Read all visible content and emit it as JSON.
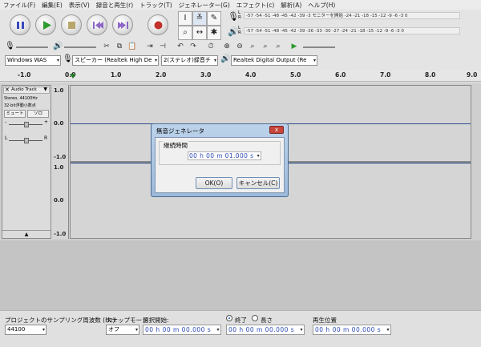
{
  "menu": [
    "ファイル(F)",
    "編集(E)",
    "表示(V)",
    "録音と再生(r)",
    "トラック(T)",
    "ジェネレーター(G)",
    "エフェクト(c)",
    "解析(A)",
    "ヘルプ(H)"
  ],
  "meters": {
    "record_scale": "-57 -54 -51 -48 -45 -42 -39 -3 モニターを開始 -24 -21 -18 -15 -12 -9 -6 -3 0",
    "play_scale": "-57 -54 -51 -48 -45 -42 -39 -36 -33 -30 -27 -24 -21 -18 -15 -12 -9 -6 -3 0",
    "record_lr": "L R",
    "play_lr": "L R"
  },
  "devices": {
    "host": "Windows WAS",
    "playback": "スピーカー (Realtek High De",
    "channels": "2(ステレオ)録音チ",
    "recording": "Realtek Digital Output (Re"
  },
  "ruler": {
    "labels": [
      "-1.0",
      "0.0",
      "1.0",
      "2.0",
      "3.0",
      "4.0",
      "5.0",
      "6.0",
      "7.0",
      "8.0",
      "9.0"
    ]
  },
  "track": {
    "name": "Audio Track",
    "info1": "Stereo, 44100Hz",
    "info2": "32-bit浮動小数点",
    "mute": "ミュート",
    "solo": "ソロ",
    "gain_minus": "-",
    "gain_plus": "+",
    "pan_left": "L",
    "pan_right": "R",
    "scale": [
      "1.0",
      "0.0",
      "-1.0",
      "1.0",
      "0.0",
      "-1.0"
    ]
  },
  "dialog": {
    "title": "無音ジェネレータ",
    "close": "x",
    "group_label": "継続時間",
    "duration": "00 h 00 m 01.000 s",
    "ok": "OK(O)",
    "cancel": "キャンセル(C)"
  },
  "selection": {
    "rate_label": "プロジェクトのサンプリング周波数 (Hz):",
    "rate_value": "44100",
    "snap_label": "スナップモード",
    "snap_value": "オフ",
    "start_label": "選択開始:",
    "start_value": "00 h 00 m 00.000 s",
    "end_radio": "終了",
    "length_radio": "長さ",
    "end_value": "00 h 00 m 00.000 s",
    "pos_label": "再生位置",
    "pos_value": "00 h 00 m 00.000 s"
  }
}
